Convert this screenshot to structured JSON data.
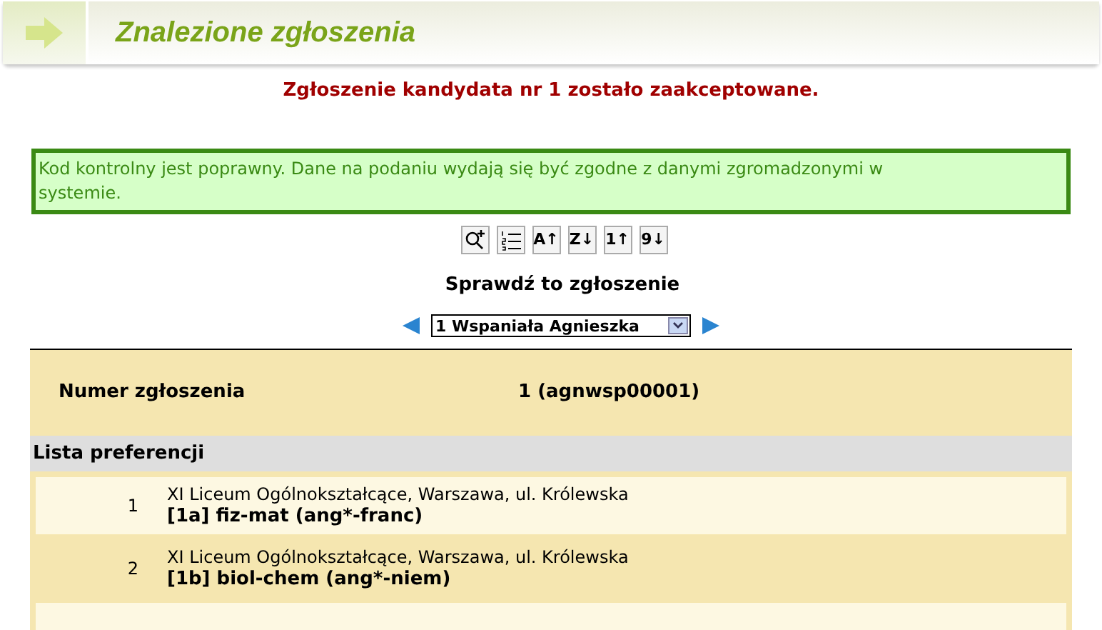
{
  "header": {
    "title": "Znalezione zgłoszenia"
  },
  "message": "Zgłoszenie kandydata nr 1 zostało zaakceptowane.",
  "notice": "Kod kontrolny jest poprawny. Dane na podaniu wydają się być zgodne z danymi zgromadzonymi w systemie.",
  "toolbar": [
    {
      "kind": "zoom"
    },
    {
      "kind": "list"
    },
    {
      "kind": "sort",
      "letter": "A",
      "arrow": "↑"
    },
    {
      "kind": "sort",
      "letter": "Z",
      "arrow": "↓"
    },
    {
      "kind": "sort",
      "letter": "1",
      "arrow": "↑"
    },
    {
      "kind": "sort",
      "letter": "9",
      "arrow": "↓"
    }
  ],
  "check_title": "Sprawdź to zgłoszenie",
  "selector": {
    "value": "1 Wspaniała Agnieszka"
  },
  "number_row": {
    "label": "Numer zgłoszenia",
    "value": "1 (agnwsp00001)"
  },
  "preferences": {
    "title": "Lista preferencji",
    "rows": [
      {
        "index": "1",
        "school": "XI Liceum Ogólnokształcące, Warszawa, ul. Królewska",
        "profile": "[1a] fiz-mat (ang*-franc)"
      },
      {
        "index": "2",
        "school": "XI Liceum Ogólnokształcące, Warszawa, ul. Królewska",
        "profile": "[1b] biol-chem (ang*-niem)"
      }
    ]
  }
}
